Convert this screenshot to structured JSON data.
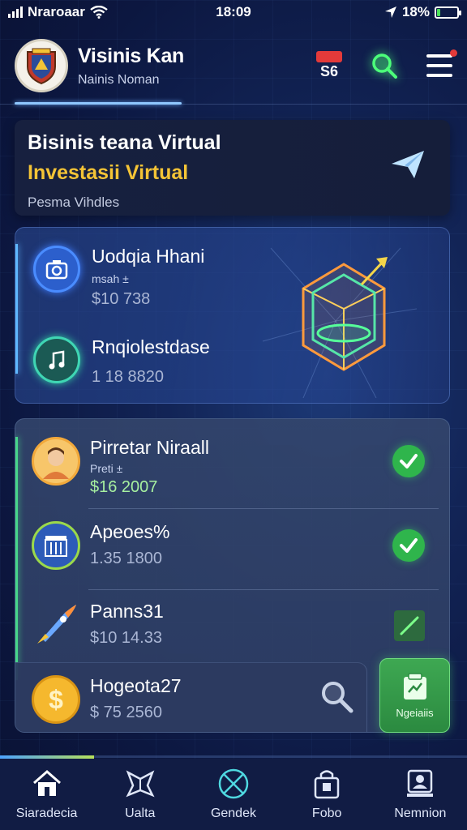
{
  "status_bar": {
    "carrier": "Nraroaar",
    "time": "18:09",
    "battery": "18%",
    "battery_level": 0.18
  },
  "header": {
    "user_name": "Visinis Kan",
    "user_sub": "Nainis Noman",
    "notification_count": "S6"
  },
  "banner": {
    "title": "Bisinis teana Virtual",
    "highlight": "Investasii Virtual",
    "subtitle": "Pesma Vihdles"
  },
  "card1": {
    "items": [
      {
        "title": "Uodqia Hhani",
        "sub": "msah ±",
        "value": "$10 738"
      },
      {
        "title": "Rnqiolestdase",
        "value": "1 18 8820"
      }
    ]
  },
  "list": {
    "items": [
      {
        "title": "Pirretar Niraall",
        "sub": "Preti ±",
        "value": "$16 2007",
        "status": "done"
      },
      {
        "title": "Apeoes%",
        "value": "1.35 1800",
        "status": "done"
      },
      {
        "title": "Panns31",
        "value": "$10 14.33",
        "status": "pending"
      },
      {
        "title": "Hogeota27",
        "value": "$ 75 2560"
      }
    ],
    "action_button": "Ngeiaiis"
  },
  "nav": {
    "items": [
      {
        "label": "Siaradecia",
        "icon": "home-icon"
      },
      {
        "label": "Ualta",
        "icon": "star-icon"
      },
      {
        "label": "Gendek",
        "icon": "globe-icon"
      },
      {
        "label": "Fobo",
        "icon": "bag-icon"
      },
      {
        "label": "Nemnion",
        "icon": "profile-icon"
      }
    ]
  },
  "colors": {
    "accent_green": "#2fb54c",
    "accent_gold": "#f4c436",
    "accent_blue": "#5fb8ff",
    "background": "#0c1740"
  }
}
